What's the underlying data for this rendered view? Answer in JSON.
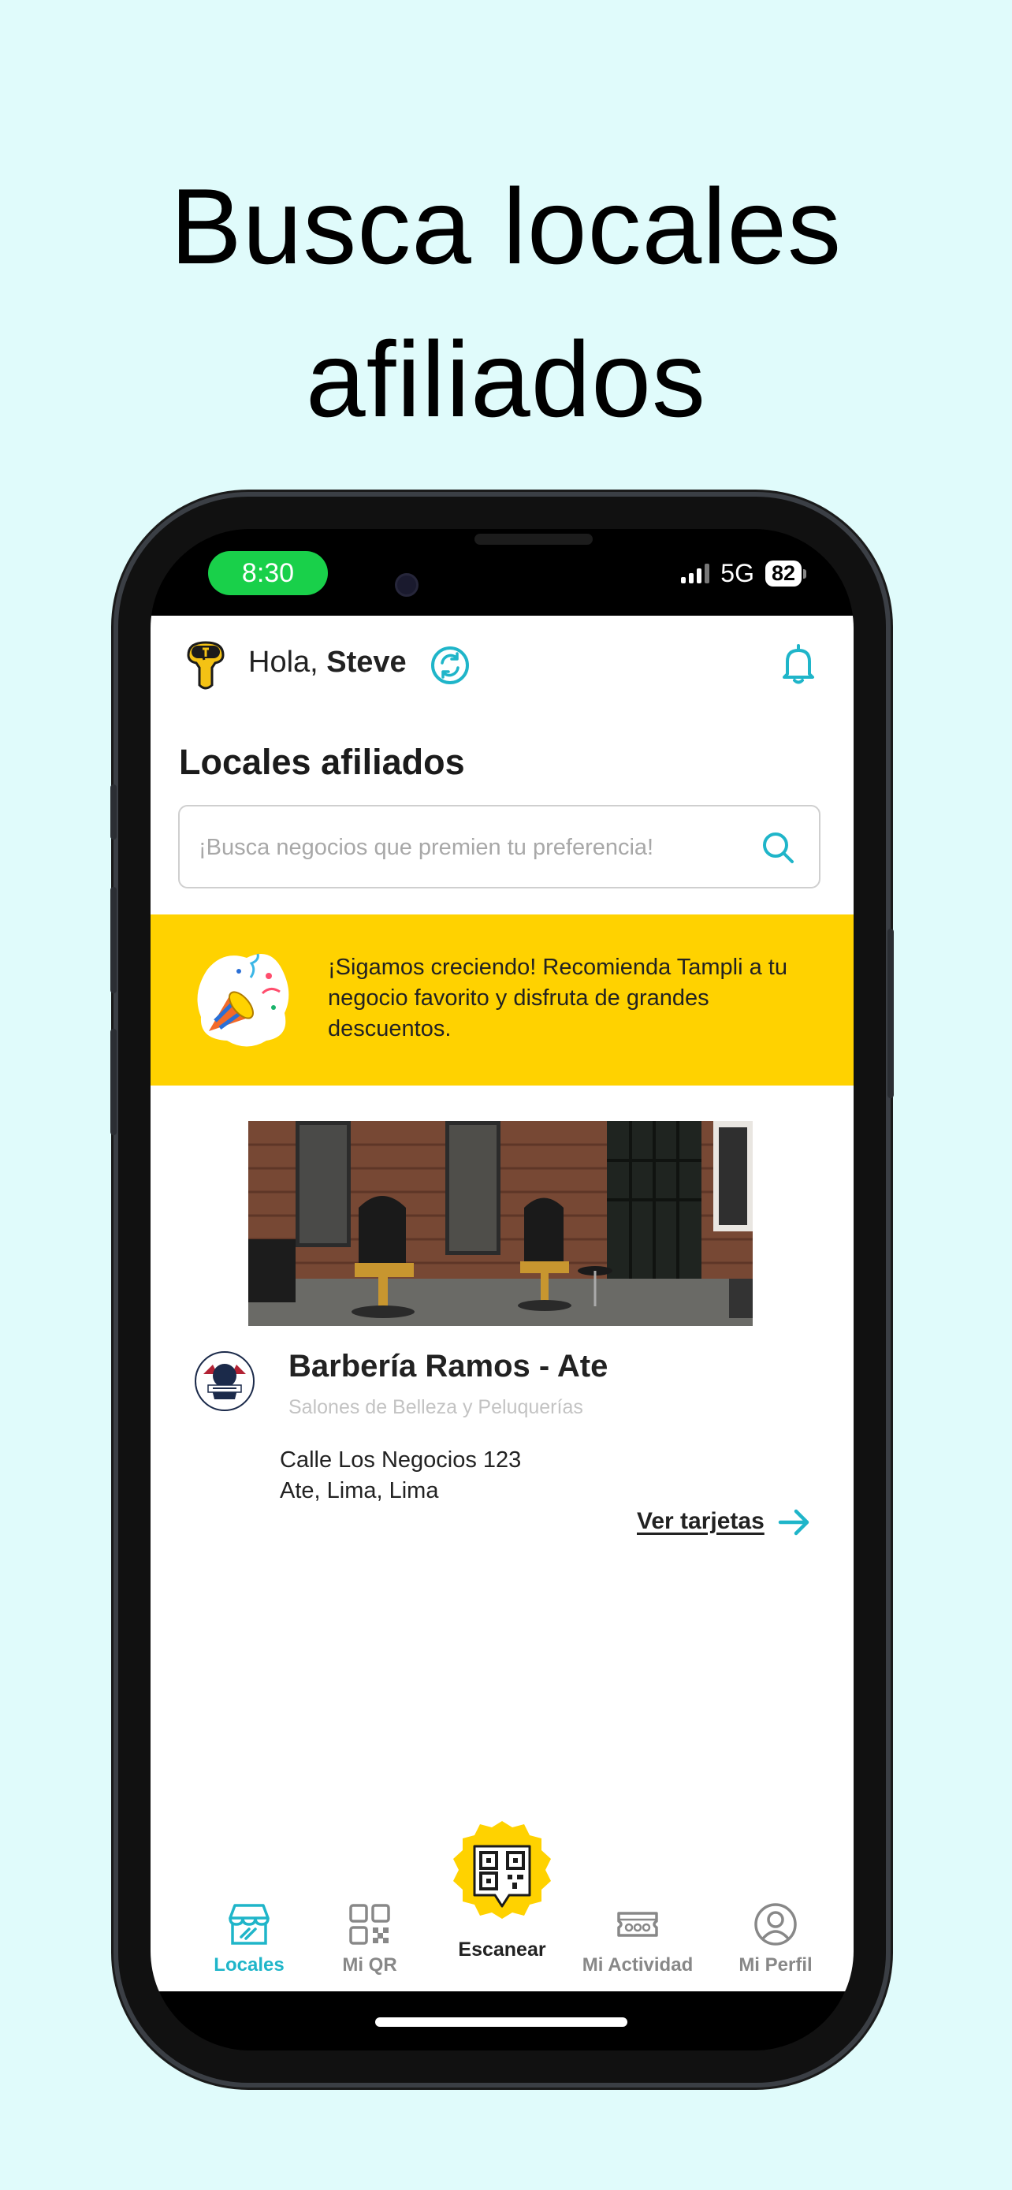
{
  "headline": {
    "line1": "Busca locales",
    "line2": "afiliados"
  },
  "status_bar": {
    "time": "8:30",
    "network": "5G",
    "battery": "82"
  },
  "header": {
    "greeting": "Hola,",
    "user_name": "Steve"
  },
  "page_title": "Locales afiliados",
  "search": {
    "placeholder": "¡Busca negocios que premien tu preferencia!",
    "value": ""
  },
  "promo_banner": {
    "text": "¡Sigamos creciendo! Recomienda Tampli a tu negocio favorito y disfruta de grandes descuentos."
  },
  "store": {
    "name": "Barbería Ramos - Ate",
    "category": "Salones de Belleza y Peluquerías",
    "address_line1": "Calle Los Negocios 123",
    "address_line2": "Ate, Lima, Lima",
    "link_label": "Ver tarjetas"
  },
  "bottom_nav": {
    "locales": "Locales",
    "mi_qr": "Mi QR",
    "escanear": "Escanear",
    "mi_actividad": "Mi Actividad",
    "mi_perfil": "Mi Perfil"
  },
  "colors": {
    "background": "#e0fbfb",
    "accent": "#1fb5c9",
    "banner": "#ffd200",
    "status_pill": "#19d04a"
  },
  "icons": [
    "tampli-logo-icon",
    "switch-icon",
    "bell-icon",
    "search-icon",
    "party-popper-icon",
    "barber-logo-icon",
    "arrow-right-icon",
    "store-icon",
    "qr-icon",
    "scan-qr-icon",
    "ticket-icon",
    "user-icon"
  ]
}
